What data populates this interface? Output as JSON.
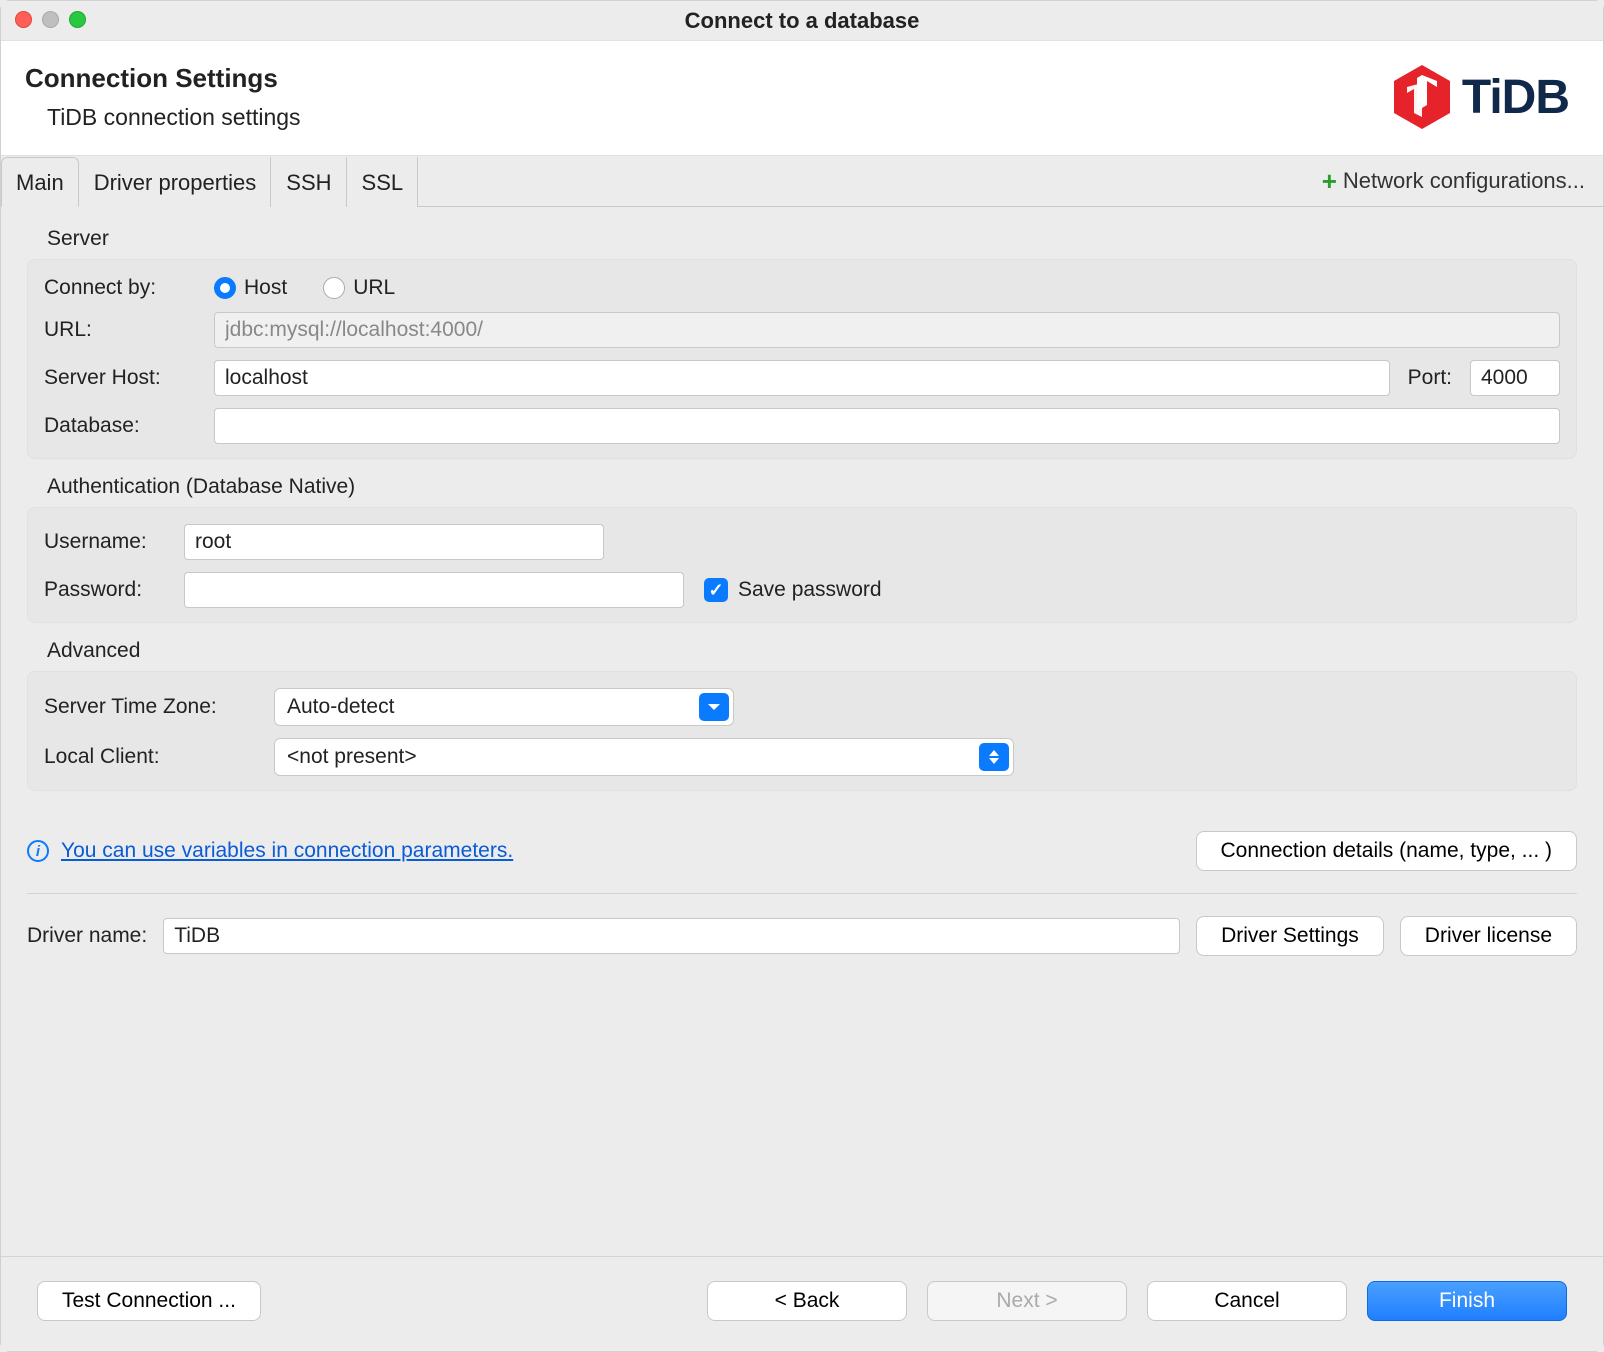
{
  "window": {
    "title": "Connect to a database"
  },
  "header": {
    "title": "Connection Settings",
    "subtitle": "TiDB connection settings",
    "brand": "TiDB"
  },
  "tabs": [
    "Main",
    "Driver properties",
    "SSH",
    "SSL"
  ],
  "network_configs_label": "Network configurations...",
  "server": {
    "section_label": "Server",
    "connect_by_label": "Connect by:",
    "host_option": "Host",
    "url_option": "URL",
    "url_label": "URL:",
    "url_value": "jdbc:mysql://localhost:4000/",
    "host_label": "Server Host:",
    "host_value": "localhost",
    "port_label": "Port:",
    "port_value": "4000",
    "database_label": "Database:",
    "database_value": ""
  },
  "auth": {
    "section_label": "Authentication (Database Native)",
    "username_label": "Username:",
    "username_value": "root",
    "password_label": "Password:",
    "password_value": "",
    "save_password_label": "Save password"
  },
  "advanced": {
    "section_label": "Advanced",
    "tz_label": "Server Time Zone:",
    "tz_value": "Auto-detect",
    "local_client_label": "Local Client:",
    "local_client_value": "<not present>"
  },
  "hint": {
    "link_text": "You can use variables in connection parameters.",
    "details_button": "Connection details (name, type, ... )"
  },
  "driver": {
    "label": "Driver name:",
    "value": "TiDB",
    "settings_button": "Driver Settings",
    "license_button": "Driver license"
  },
  "footer": {
    "test_button": "Test Connection ...",
    "back_button": "< Back",
    "next_button": "Next >",
    "cancel_button": "Cancel",
    "finish_button": "Finish"
  }
}
